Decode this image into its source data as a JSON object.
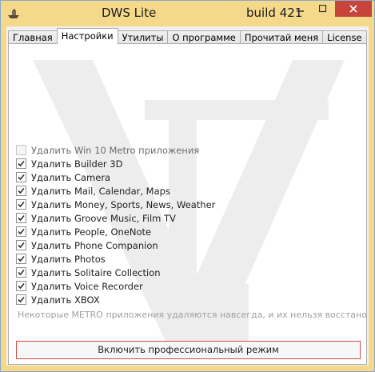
{
  "window": {
    "title": "DWS Lite",
    "build": "build 421",
    "app_icon": "ship-icon",
    "controls": [
      "minimize-icon",
      "maximize-icon",
      "close-icon"
    ],
    "close_color": "#c7443b",
    "frame_color": "#f5d98a"
  },
  "tabs": [
    {
      "label": "Главная",
      "active": false
    },
    {
      "label": "Настройки",
      "active": true
    },
    {
      "label": "Утилиты",
      "active": false
    },
    {
      "label": "О программе",
      "active": false
    },
    {
      "label": "Прочитай меня",
      "active": false
    },
    {
      "label": "License",
      "active": false
    }
  ],
  "settings": {
    "items": [
      {
        "label": "Удалить Win 10 Metro приложения",
        "checked": false,
        "enabled": false
      },
      {
        "label": "Удалить Builder 3D",
        "checked": true,
        "enabled": true
      },
      {
        "label": "Удалить Camera",
        "checked": true,
        "enabled": true
      },
      {
        "label": "Удалить Mail, Calendar, Maps",
        "checked": true,
        "enabled": true
      },
      {
        "label": "Удалить Money, Sports, News, Weather",
        "checked": true,
        "enabled": true
      },
      {
        "label": "Удалить Groove Music, Film TV",
        "checked": true,
        "enabled": true
      },
      {
        "label": "Удалить People, OneNote",
        "checked": true,
        "enabled": true
      },
      {
        "label": "Удалить Phone Companion",
        "checked": true,
        "enabled": true
      },
      {
        "label": "Удалить Photos",
        "checked": true,
        "enabled": true
      },
      {
        "label": "Удалить Solitaire Collection",
        "checked": true,
        "enabled": true
      },
      {
        "label": "Удалить Voice Recorder",
        "checked": true,
        "enabled": true
      },
      {
        "label": "Удалить XBOX",
        "checked": true,
        "enabled": true
      }
    ],
    "note": "Некоторые METRO приложения удаляются навсегда, и их нельзя восстановить",
    "pro_button_label": "Включить профессиональный режим",
    "pro_button_border_color": "#c9504b"
  }
}
